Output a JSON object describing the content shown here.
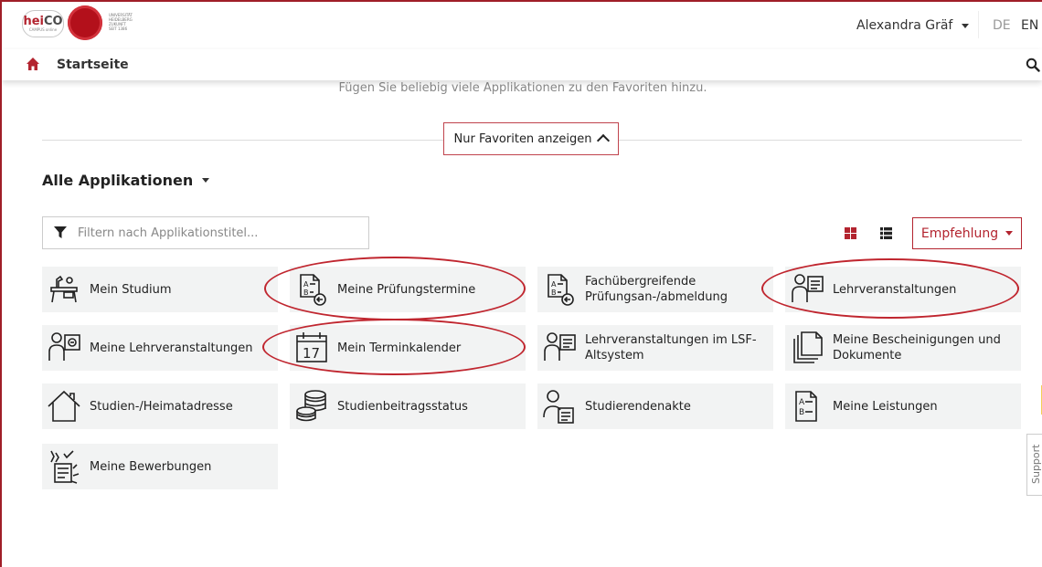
{
  "header": {
    "logo_text_a": "hei",
    "logo_text_b": "CO",
    "logo_sub": "CAMPUS online",
    "uni_text": [
      "UNIVERSITÄT",
      "HEIDELBERG",
      "ZUKUNFT",
      "SEIT 1386"
    ],
    "user_name": "Alexandra Gräf",
    "lang_de": "DE",
    "lang_en": "EN"
  },
  "nav": {
    "label": "Startseite"
  },
  "hint": "Fügen Sie beliebig viele Applikationen zu den Favoriten hinzu.",
  "favorites_button": "Nur Favoriten anzeigen",
  "section_title": "Alle Applikationen",
  "filter": {
    "placeholder": "Filtern nach Applikationstitel..."
  },
  "recommend_label": "Empfehlung",
  "support_label": "Support",
  "tiles": [
    {
      "label": "Mein Studium",
      "icon": "desk-icon"
    },
    {
      "label": "Meine Prüfungstermine",
      "icon": "exam-return-icon"
    },
    {
      "label": "Fachübergreifende Prüfungsan-/abmeldung",
      "icon": "exam-register-icon"
    },
    {
      "label": "Lehrveranstaltungen",
      "icon": "person-list-icon"
    },
    {
      "label": "Meine Lehrveranstaltungen",
      "icon": "person-screen-icon"
    },
    {
      "label": "Mein Terminkalender",
      "icon": "calendar-icon",
      "day": "17"
    },
    {
      "label": "Lehrveranstaltungen im LSF-Altsystem",
      "icon": "person-list-icon"
    },
    {
      "label": "Meine Bescheinigungen und Dokumente",
      "icon": "documents-icon"
    },
    {
      "label": "Studien-/Heimatadresse",
      "icon": "house-icon"
    },
    {
      "label": "Studienbeitragsstatus",
      "icon": "coins-icon"
    },
    {
      "label": "Studierendenakte",
      "icon": "student-file-icon"
    },
    {
      "label": "Meine Leistungen",
      "icon": "grades-icon"
    },
    {
      "label": "Meine Bewerbungen",
      "icon": "applications-icon"
    }
  ],
  "colors": {
    "accent": "#b3242f",
    "tile_bg": "#f2f3f3",
    "annotation": "#c0262f"
  }
}
